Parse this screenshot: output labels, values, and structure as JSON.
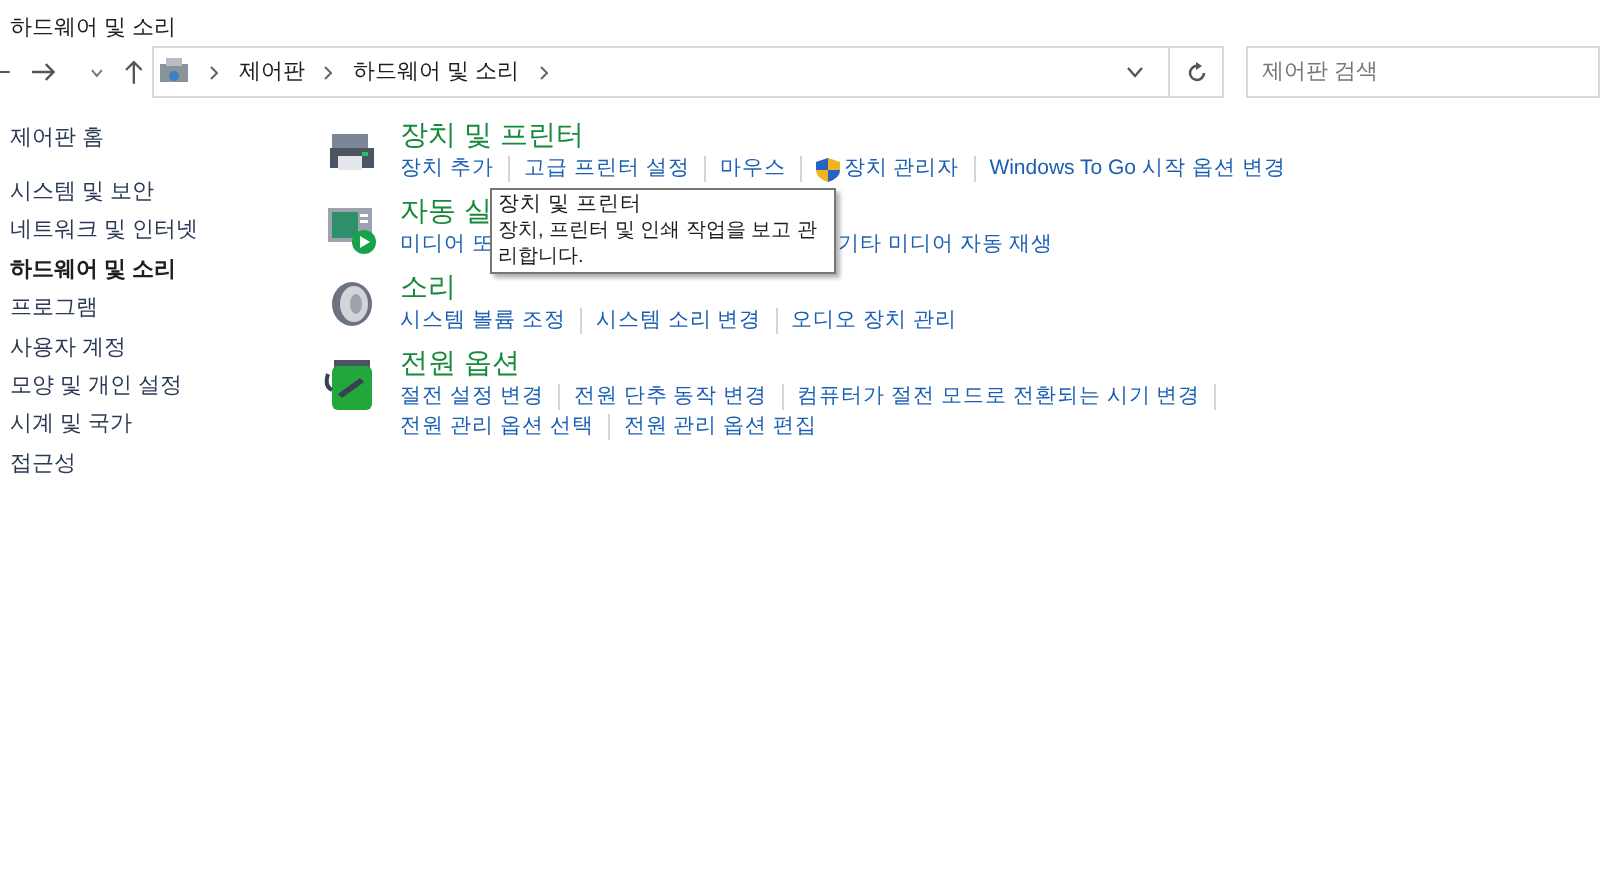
{
  "window": {
    "title": "하드웨어 및 소리"
  },
  "address": {
    "crumbs": [
      "제어판",
      "하드웨어 및 소리"
    ],
    "search_placeholder": "제어판 검색"
  },
  "sidebar": {
    "items": [
      {
        "label": "제어판 홈",
        "selected": false
      },
      {
        "label": "시스템 및 보안",
        "selected": false
      },
      {
        "label": "네트워크 및 인터넷",
        "selected": false
      },
      {
        "label": "하드웨어 및 소리",
        "selected": true
      },
      {
        "label": "프로그램",
        "selected": false
      },
      {
        "label": "사용자 계정",
        "selected": false
      },
      {
        "label": "모양 및 개인 설정",
        "selected": false
      },
      {
        "label": "시계 및 국가",
        "selected": false
      },
      {
        "label": "접근성",
        "selected": false
      }
    ]
  },
  "categories": [
    {
      "kind": "printer",
      "title": "장치 및 프린터",
      "lines": [
        [
          {
            "text": "장치 추가",
            "kind": "plain"
          },
          {
            "text": "고급 프린터 설정",
            "kind": "plain"
          },
          {
            "text": "마우스",
            "kind": "plain"
          },
          {
            "text": "장치 관리자",
            "kind": "shield"
          },
          {
            "text": "Windows To Go 시작 옵션 변경",
            "kind": "plain"
          }
        ]
      ]
    },
    {
      "kind": "autoplay",
      "title": "자동 실",
      "lines": [
        [
          {
            "text": "미디어 또",
            "kind": "covered"
          },
          {
            "text": "기타 미디어 자동 재생",
            "kind": "plain"
          }
        ]
      ]
    },
    {
      "kind": "speaker",
      "title": "소리",
      "lines": [
        [
          {
            "text": "시스템 볼륨 조정",
            "kind": "plain"
          },
          {
            "text": "시스템 소리 변경",
            "kind": "plain"
          },
          {
            "text": "오디오 장치 관리",
            "kind": "plain"
          }
        ]
      ]
    },
    {
      "kind": "battery",
      "title": "전원 옵션",
      "trailing_separator": true,
      "lines": [
        [
          {
            "text": "절전 설정 변경",
            "kind": "plain"
          },
          {
            "text": "전원 단추 동작 변경",
            "kind": "plain"
          },
          {
            "text": "컴퓨터가 절전 모드로 전환되는 시기 변경",
            "kind": "plain"
          }
        ],
        [
          {
            "text": "전원 관리 옵션 선택",
            "kind": "plain"
          },
          {
            "text": "전원 관리 옵션 편집",
            "kind": "plain"
          }
        ]
      ]
    }
  ],
  "tooltip": {
    "title": "장치 및 프린터",
    "text": "장치, 프린터 및 인쇄 작업을 보고 관리합니다."
  }
}
